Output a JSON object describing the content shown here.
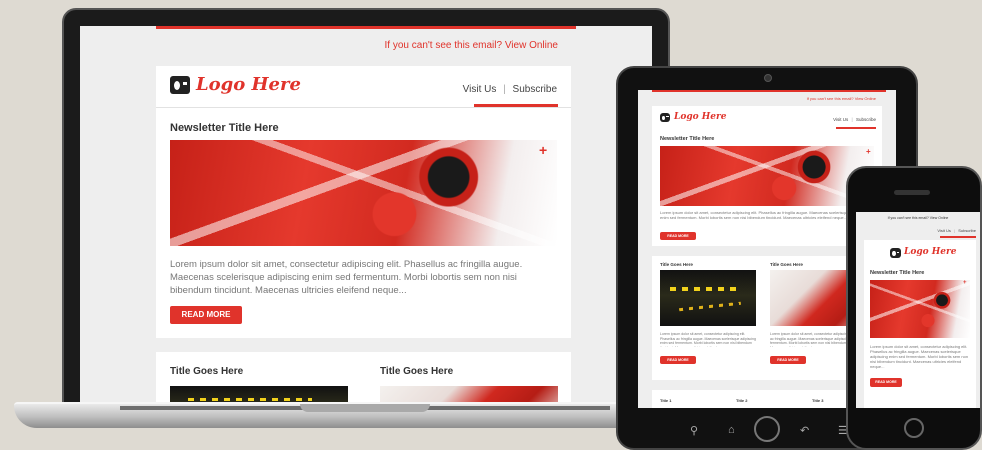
{
  "newsletter": {
    "view_online": "If you can't see this email? View Online",
    "logo_text": "Logo Here",
    "nav": {
      "visit": "Visit Us",
      "separator": "|",
      "subscribe": "Subscribe"
    },
    "title": "Newsletter Title Here",
    "body": "Lorem ipsum dolor sit amet, consectetur adipiscing elit. Phasellus ac fringilla augue. Maecenas scelerisque adipiscing enim sed fermentum. Morbi lobortis sem non nisi bibendum tincidunt. Maecenas ultricies eleifend neque...",
    "read_more": "READ MORE",
    "plus": "+",
    "columns": [
      {
        "title": "Title Goes Here"
      },
      {
        "title": "Title Goes Here"
      }
    ],
    "small_cols": [
      "Title 1",
      "Title 2",
      "Title 3"
    ]
  },
  "colors": {
    "accent": "#e0332b",
    "background": "#dedad2"
  },
  "icons": {
    "logo": "radio-icon",
    "tablet_keys": [
      "search-icon",
      "home-icon",
      "home-button",
      "back-icon",
      "menu-icon"
    ],
    "phone_key": "home-button"
  }
}
